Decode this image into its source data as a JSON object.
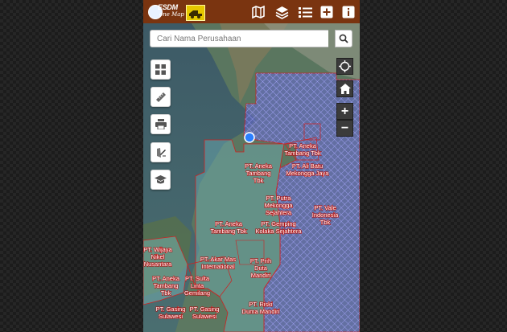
{
  "app": {
    "logo_text": "ESDM",
    "logo_subtext": "one Map"
  },
  "toolbar": {
    "icons": [
      "map-icon",
      "layers-icon",
      "list-icon",
      "plus-square-icon",
      "info-icon"
    ]
  },
  "search": {
    "placeholder": "Cari Nama Perusahaan",
    "button_icon": "search-icon"
  },
  "tools": [
    "grid-icon",
    "ruler-icon",
    "print-icon",
    "edit-icon",
    "graduation-icon"
  ],
  "controls": [
    "locate-icon",
    "home-icon",
    "zoom-in",
    "zoom-out"
  ],
  "zoom": {
    "in_label": "+",
    "out_label": "−"
  },
  "map": {
    "labels": [
      {
        "lines": [
          "PT. Aneka",
          "Tambang Tbk"
        ]
      },
      {
        "lines": [
          "PT. Aneka",
          "Tambang",
          "Tbk"
        ]
      },
      {
        "lines": [
          "PT. Ali Batu",
          "Mekongga Jaya"
        ]
      },
      {
        "lines": [
          "PT. Putra",
          "Mekongga",
          "Sejahtera"
        ]
      },
      {
        "lines": [
          "PT. Vale",
          "Indonesia",
          "Tbk"
        ]
      },
      {
        "lines": [
          "PT. Aneka",
          "Tambang Tbk"
        ]
      },
      {
        "lines": [
          "PT. Gemping",
          "Kolaka Sejahtera"
        ]
      },
      {
        "lines": [
          "PT. Wijaya",
          "Nikel",
          "Nusantara"
        ]
      },
      {
        "lines": [
          "PT. Akar Mas",
          "International"
        ]
      },
      {
        "lines": [
          "PT. Prih",
          "Duta",
          "Mandiri"
        ]
      },
      {
        "lines": [
          "PT. Aneka",
          "Tambang",
          "Tbk"
        ]
      },
      {
        "lines": [
          "PT. Sulta",
          "Linta",
          "Gemilang"
        ]
      },
      {
        "lines": [
          "PT. Riski",
          "Duma Mandiri"
        ]
      },
      {
        "lines": [
          "PT. Gasing",
          "Sulawesi"
        ]
      },
      {
        "lines": [
          "PT. Gasing",
          "Sulawesi"
        ]
      }
    ]
  },
  "colors": {
    "topbar": "#7a3410",
    "concession_fill": "#6a6ad8",
    "boundary": "#d02020",
    "location_dot": "#2a7fff"
  }
}
